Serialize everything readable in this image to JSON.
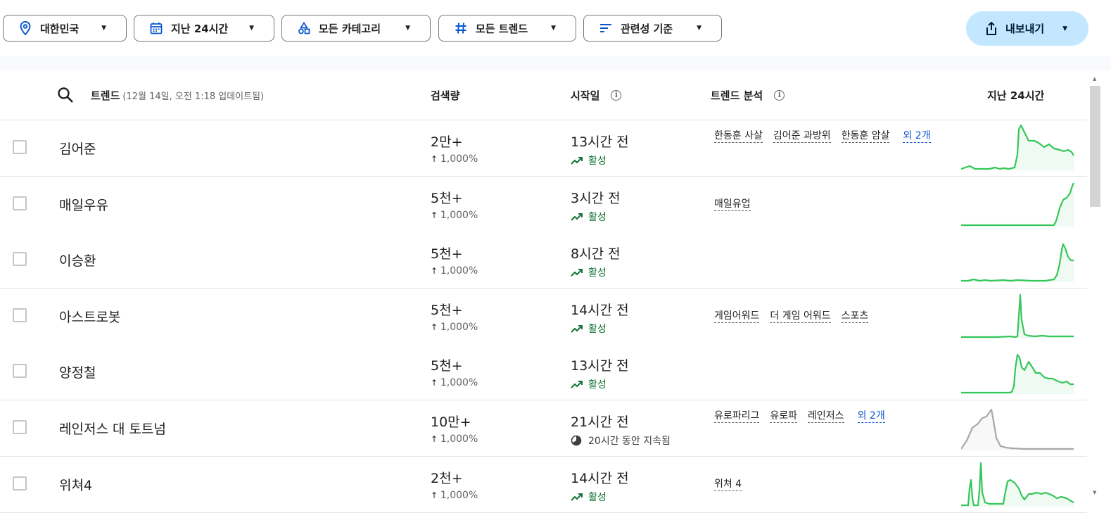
{
  "filters": {
    "region": "대한민국",
    "time": "지난 24시간",
    "category": "모든 카테고리",
    "trend": "모든 트렌드",
    "sort": "관련성 기준",
    "export": "내보내기"
  },
  "table": {
    "header": {
      "trend": "트렌드",
      "updated": "(12월 14일, 오전 1:18 업데이트됨)",
      "volume": "검색량",
      "started": "시작일",
      "analysis": "트렌드 분석",
      "past24": "지난 24시간"
    },
    "rows": [
      {
        "name": "김어준",
        "volume": "2만+",
        "pct": "1,000%",
        "started": "13시간 전",
        "status": "활성",
        "status_type": "active",
        "keywords": [
          "한동훈 사살",
          "김어준 과방위",
          "한동훈 암살"
        ],
        "more": "외 2개",
        "color": "#34c759"
      },
      {
        "name": "매일우유",
        "volume": "5천+",
        "pct": "1,000%",
        "started": "3시간 전",
        "status": "활성",
        "status_type": "active",
        "keywords": [
          "매일유업"
        ],
        "more": "",
        "color": "#34c759"
      },
      {
        "name": "이승환",
        "volume": "5천+",
        "pct": "1,000%",
        "started": "8시간 전",
        "status": "활성",
        "status_type": "active",
        "keywords": [],
        "more": "",
        "color": "#34c759"
      },
      {
        "name": "아스트로봇",
        "volume": "5천+",
        "pct": "1,000%",
        "started": "14시간 전",
        "status": "활성",
        "status_type": "active",
        "keywords": [
          "게임어워드",
          "더 게임 어워드",
          "스포츠"
        ],
        "more": "",
        "color": "#34c759"
      },
      {
        "name": "양정철",
        "volume": "5천+",
        "pct": "1,000%",
        "started": "13시간 전",
        "status": "활성",
        "status_type": "active",
        "keywords": [],
        "more": "",
        "color": "#34c759"
      },
      {
        "name": "레인저스 대 토트넘",
        "volume": "10만+",
        "pct": "1,000%",
        "started": "21시간 전",
        "status": "20시간 동안 지속됨",
        "status_type": "ended",
        "keywords": [
          "유로파리그",
          "유로파",
          "레인저스"
        ],
        "more": "외 2개",
        "color": "#a8a8a8"
      },
      {
        "name": "위쳐4",
        "volume": "2천+",
        "pct": "1,000%",
        "started": "14시간 전",
        "status": "활성",
        "status_type": "active",
        "keywords": [
          "위쳐 4"
        ],
        "more": "",
        "color": "#34c759"
      }
    ]
  }
}
